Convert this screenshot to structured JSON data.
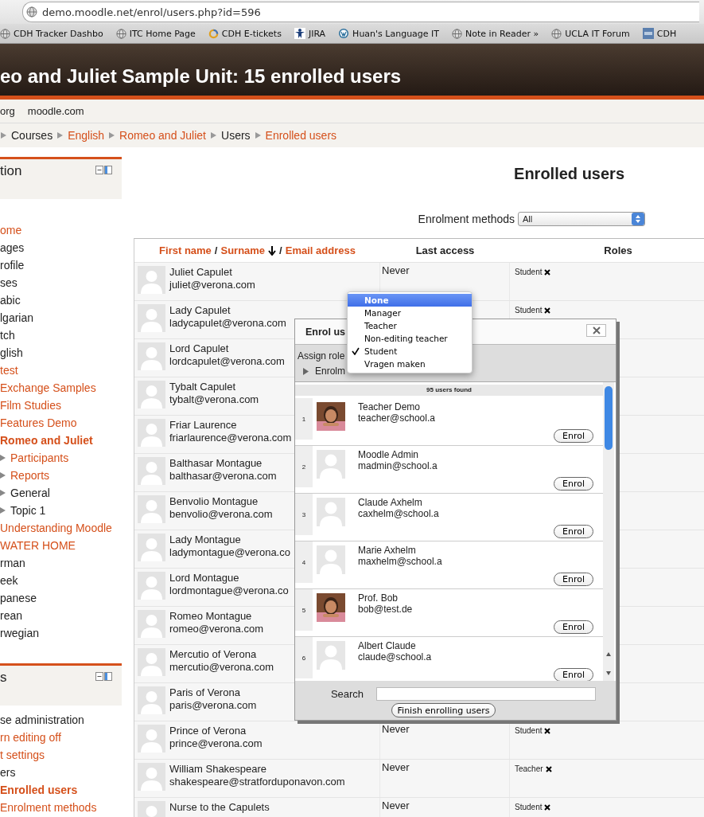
{
  "browser": {
    "url": "demo.moodle.net/enrol/users.php?id=596",
    "bookmarks": [
      {
        "label": "CDH Tracker Dashbo",
        "kind": "globe"
      },
      {
        "label": "ITC Home Page",
        "kind": "globe"
      },
      {
        "label": "CDH E-tickets",
        "kind": "ring"
      },
      {
        "label": "JIRA",
        "kind": "figure"
      },
      {
        "label": "Huan's Language IT",
        "kind": "circle"
      },
      {
        "label": "Note in Reader »",
        "kind": "globe"
      },
      {
        "label": "UCLA IT Forum",
        "kind": "globe"
      },
      {
        "label": "CDH",
        "kind": "square"
      }
    ]
  },
  "header": {
    "title": "eo and Juliet Sample Unit: 15 enrolled users"
  },
  "nav_links": [
    "org",
    "moodle.com"
  ],
  "breadcrumb": [
    {
      "label": "Courses",
      "link": false
    },
    {
      "label": "English",
      "link": true
    },
    {
      "label": "Romeo and Juliet",
      "link": true
    },
    {
      "label": "Users",
      "link": false
    },
    {
      "label": "Enrolled users",
      "link": true
    }
  ],
  "blocks": [
    {
      "title": "tion",
      "items": [
        {
          "label": "ome",
          "link": true,
          "current": false
        },
        {
          "label": "ages",
          "link": false,
          "current": false
        },
        {
          "label": "rofile",
          "link": false,
          "current": false
        },
        {
          "label": "ses",
          "link": false,
          "current": false
        },
        {
          "label": "abic",
          "link": false,
          "current": false
        },
        {
          "label": "lgarian",
          "link": false,
          "current": false
        },
        {
          "label": "tch",
          "link": false,
          "current": false
        },
        {
          "label": "glish",
          "link": false,
          "current": false
        },
        {
          "label": "test",
          "link": true,
          "current": false
        },
        {
          "label": "Exchange Samples",
          "link": true,
          "current": false
        },
        {
          "label": "Film Studies",
          "link": true,
          "current": false
        },
        {
          "label": "Features Demo",
          "link": true,
          "current": false
        },
        {
          "label": "Romeo and Juliet",
          "link": true,
          "current": true,
          "children": [
            {
              "label": "Participants",
              "link": true,
              "current": false
            },
            {
              "label": "Reports",
              "link": true,
              "current": false
            },
            {
              "label": "General",
              "link": false,
              "current": false
            },
            {
              "label": "Topic 1",
              "link": false,
              "current": false
            }
          ]
        },
        {
          "label": "Understanding Moodle",
          "link": true,
          "current": false
        },
        {
          "label": "WATER HOME",
          "link": true,
          "current": false
        },
        {
          "label": "rman",
          "link": false,
          "current": false
        },
        {
          "label": "eek",
          "link": false,
          "current": false
        },
        {
          "label": "panese",
          "link": false,
          "current": false
        },
        {
          "label": "rean",
          "link": false,
          "current": false
        },
        {
          "label": "rwegian",
          "link": false,
          "current": false
        }
      ]
    },
    {
      "title": "s",
      "items": [
        {
          "label": "se administration",
          "link": false,
          "current": false
        },
        {
          "label": "rn editing off",
          "link": true,
          "current": false
        },
        {
          "label": "t settings",
          "link": true,
          "current": false
        },
        {
          "label": "ers",
          "link": false,
          "current": false
        },
        {
          "label": "Enrolled users",
          "link": true,
          "current": true
        },
        {
          "label": "Enrolment methods",
          "link": true,
          "current": false
        }
      ]
    }
  ],
  "heading": "Enrolled users",
  "enrolment_filter": {
    "label": "Enrolment methods",
    "value": "All"
  },
  "table": {
    "name_header": [
      {
        "kind": "link",
        "label": "First name",
        "sorted": false
      },
      {
        "kind": "text",
        "label": "/",
        "sorted": false
      },
      {
        "kind": "link",
        "label": "Surname",
        "sorted": true
      },
      {
        "kind": "text",
        "label": "/",
        "sorted": false
      },
      {
        "kind": "link",
        "label": "Email address",
        "sorted": false
      }
    ],
    "columns": [
      "Last access",
      "Roles"
    ],
    "rows": [
      {
        "name": "Juliet Capulet",
        "email": "juliet@verona.com",
        "last_access": "Never",
        "roles": [
          "Student"
        ]
      },
      {
        "name": "Lady Capulet",
        "email": "ladycapulet@verona.com",
        "roles": [
          "Student"
        ]
      },
      {
        "name": "Lord Capulet",
        "email": "lordcapulet@verona.com"
      },
      {
        "name": "Tybalt Capulet",
        "email": "tybalt@verona.com"
      },
      {
        "name": "Friar Laurence",
        "email": "friarlaurence@verona.com"
      },
      {
        "name": "Balthasar Montague",
        "email": "balthasar@verona.com"
      },
      {
        "name": "Benvolio Montague",
        "email": "benvolio@verona.com"
      },
      {
        "name": "Lady Montague",
        "email": "ladymontague@verona.co"
      },
      {
        "name": "Lord Montague",
        "email": "lordmontague@verona.co"
      },
      {
        "name": "Romeo Montague",
        "email": "romeo@verona.com"
      },
      {
        "name": "Mercutio of Verona",
        "email": "mercutio@verona.com"
      },
      {
        "name": "Paris of Verona",
        "email": "paris@verona.com"
      },
      {
        "name": "Prince of Verona",
        "email": "prince@verona.com",
        "last_access": "Never",
        "roles": [
          "Student"
        ]
      },
      {
        "name": "William Shakespeare",
        "email": "shakespeare@stratforduponavon.com",
        "last_access": "Never",
        "roles": [
          "Teacher"
        ]
      },
      {
        "name": "Nurse to the Capulets",
        "last_access": "Never",
        "roles": [
          "Student"
        ]
      }
    ]
  },
  "dialog": {
    "title": "Enrol us",
    "assign_label": "Assign role",
    "options_label": "Enrolm",
    "count": "95 users found",
    "users": [
      {
        "num": "1",
        "name": "Teacher Demo",
        "email": "teacher@school.a",
        "kind": "picture",
        "button": "Enrol"
      },
      {
        "num": "2",
        "name": "Moodle Admin",
        "email": "madmin@school.a",
        "kind": "default",
        "button": "Enrol"
      },
      {
        "num": "3",
        "name": "Claude Axhelm",
        "email": "caxhelm@school.a",
        "kind": "default",
        "button": "Enrol"
      },
      {
        "num": "4",
        "name": "Marie Axhelm",
        "email": "maxhelm@school.a",
        "kind": "default",
        "button": "Enrol"
      },
      {
        "num": "5",
        "name": "Prof. Bob",
        "email": "bob@test.de",
        "kind": "picture",
        "button": "Enrol"
      },
      {
        "num": "6",
        "name": "Albert Claude",
        "email": "claude@school.a",
        "kind": "default",
        "button": "Enrol"
      }
    ],
    "search_label": "Search",
    "finish_button": "Finish enrolling users"
  },
  "role_menu": {
    "items": [
      {
        "label": "None",
        "selected": true,
        "checked": false
      },
      {
        "label": "Manager",
        "selected": false,
        "checked": false
      },
      {
        "label": "Teacher",
        "selected": false,
        "checked": false
      },
      {
        "label": "Non-editing teacher",
        "selected": false,
        "checked": false
      },
      {
        "label": "Student",
        "selected": false,
        "checked": true
      },
      {
        "label": "Vragen maken",
        "selected": false,
        "checked": false
      }
    ]
  }
}
